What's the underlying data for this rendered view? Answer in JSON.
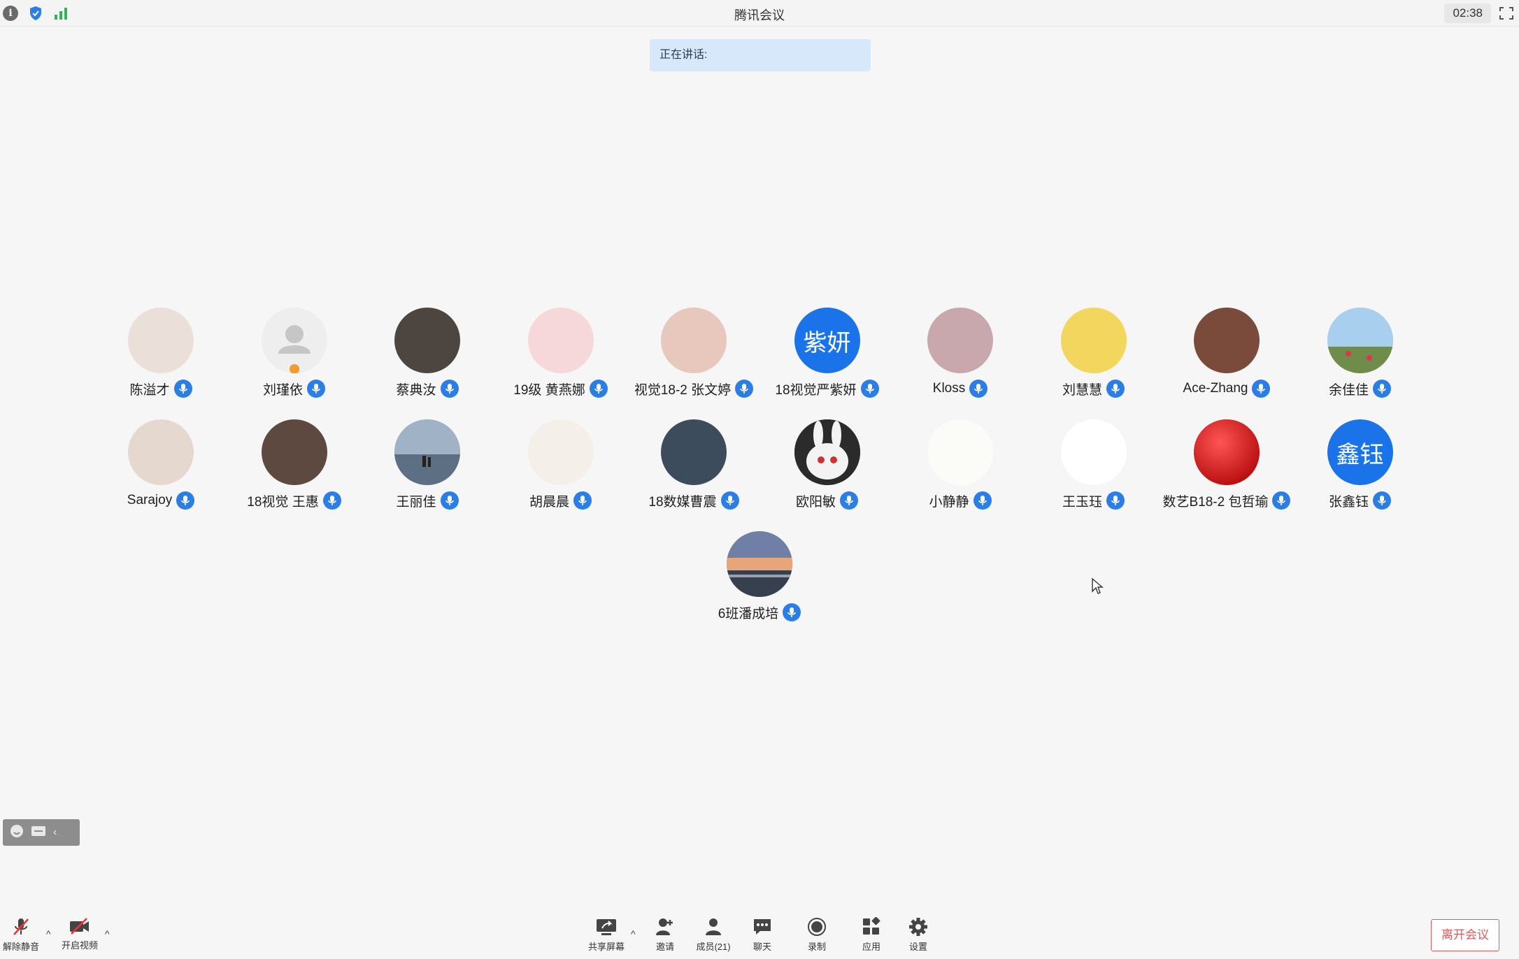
{
  "window": {
    "title": "腾讯会议",
    "clock": "02:38"
  },
  "speaking_banner": {
    "label": "正在讲话:"
  },
  "participants": [
    {
      "name": "陈溢才",
      "avatar": "anime-girl-photo",
      "bg": "#eadfd9"
    },
    {
      "name": "刘瑾依",
      "avatar": "default-user",
      "bg": "#eeeeee"
    },
    {
      "name": "蔡典汝",
      "avatar": "dog-photo",
      "bg": "#4d4540"
    },
    {
      "name": "19级 黄燕娜",
      "avatar": "bow-photo",
      "bg": "#f7d8da"
    },
    {
      "name": "视觉18-2 张文婷",
      "avatar": "illustration-photo",
      "bg": "#e8c7bd"
    },
    {
      "name": "18视觉严紫妍",
      "avatar_text": "紫妍",
      "bg": "#1a73e8"
    },
    {
      "name": "Kloss",
      "avatar": "girl-photo",
      "bg": "#c9a8ad"
    },
    {
      "name": "刘慧慧",
      "avatar": "child-photo",
      "bg": "#f3d65e"
    },
    {
      "name": "Ace-Zhang",
      "avatar": "glasses-photo",
      "bg": "#7a4b3a"
    },
    {
      "name": "余佳佳",
      "avatar": "meadow-photo",
      "bg": "#9cc3e3"
    },
    {
      "name": "Sarajoy",
      "avatar": "room-photo",
      "bg": "#e5d8cf"
    },
    {
      "name": "18视觉 王惠",
      "avatar": "portrait-photo",
      "bg": "#5e4940"
    },
    {
      "name": "王丽佳",
      "avatar": "beach-photo",
      "bg": "#8ea3b8"
    },
    {
      "name": "胡晨晨",
      "avatar": "fox-cartoon",
      "bg": "#f5efe9"
    },
    {
      "name": "18数媒曹震",
      "avatar": "man-photo",
      "bg": "#3d4c5c"
    },
    {
      "name": "欧阳敏",
      "avatar": "rabbit-photo",
      "bg": "#2b2b2b"
    },
    {
      "name": "小静静",
      "avatar": "cartoon-girl",
      "bg": "#fbfbf7"
    },
    {
      "name": "王玉珏",
      "avatar": "sketch-drawing",
      "bg": "#ffffff"
    },
    {
      "name": "数艺B18-2 包哲瑜",
      "avatar": "red-circle",
      "bg": "#d91e1e"
    },
    {
      "name": "张鑫钰",
      "avatar_text": "鑫钰",
      "bg": "#1a73e8"
    },
    {
      "name": "6班潘成培",
      "avatar": "sunset-photo",
      "bg": "#c98c6a"
    }
  ],
  "toolbar": {
    "unmute": "解除静音",
    "start_video": "开启视频",
    "share_screen": "共享屏幕",
    "invite": "邀请",
    "members": "成员(21)",
    "chat": "聊天",
    "record": "录制",
    "apps": "应用",
    "settings": "设置",
    "leave": "离开会议"
  },
  "colors": {
    "mic_blue": "#2b7ee6",
    "leave_red": "#e35b5b",
    "speaking_bg": "#d7e8fa"
  }
}
